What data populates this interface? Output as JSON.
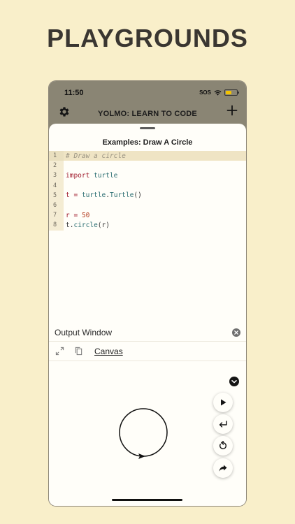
{
  "headline": "PLAYGROUNDS",
  "status_bar": {
    "time": "11:50",
    "carrier": "SOS"
  },
  "app_bar": {
    "title": "YOLMO: LEARN TO CODE",
    "settings_icon": "gear-icon",
    "add_icon": "plus-icon"
  },
  "sheet": {
    "title": "Examples: Draw A Circle"
  },
  "editor": {
    "lines": [
      {
        "number": "1",
        "text": "# Draw a circle"
      },
      {
        "number": "2",
        "text": ""
      },
      {
        "number": "3",
        "text": "import turtle"
      },
      {
        "number": "4",
        "text": ""
      },
      {
        "number": "5",
        "text": "t = turtle.Turtle()"
      },
      {
        "number": "6",
        "text": ""
      },
      {
        "number": "7",
        "text": "r = 50"
      },
      {
        "number": "8",
        "text": "t.circle(r)"
      }
    ]
  },
  "output": {
    "label": "Output Window",
    "canvas_tab": "Canvas",
    "icons": [
      "expand-icon",
      "copy-icon",
      "close-icon",
      "chevron-down-icon"
    ]
  },
  "actions": [
    {
      "name": "run-button",
      "icon": "play-icon"
    },
    {
      "name": "return-button",
      "icon": "return-icon"
    },
    {
      "name": "reset-button",
      "icon": "refresh-icon"
    },
    {
      "name": "share-button",
      "icon": "share-icon"
    }
  ],
  "colors": {
    "background": "#f9efca",
    "top_bar": "#8a8574",
    "active_line": "#efe4c4",
    "battery": "#f2c200"
  }
}
